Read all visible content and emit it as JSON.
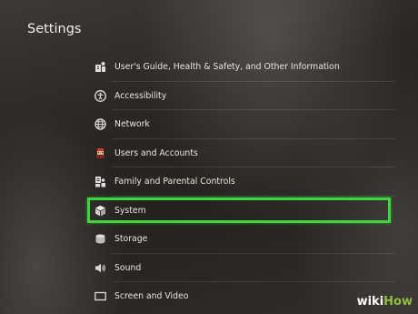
{
  "page_title": "Settings",
  "menu": [
    {
      "label": "User's Guide, Health & Safety, and Other Information",
      "icon": "guide-icon"
    },
    {
      "label": "Accessibility",
      "icon": "accessibility-icon"
    },
    {
      "label": "Network",
      "icon": "network-globe-icon"
    },
    {
      "label": "Users and Accounts",
      "icon": "user-avatar-icon"
    },
    {
      "label": "Family and Parental Controls",
      "icon": "family-icon"
    },
    {
      "label": "System",
      "icon": "system-cube-icon",
      "selected": true
    },
    {
      "label": "Storage",
      "icon": "storage-icon"
    },
    {
      "label": "Sound",
      "icon": "speaker-icon"
    },
    {
      "label": "Screen and Video",
      "icon": "screen-icon"
    }
  ],
  "highlight_color": "#3bd83b",
  "watermark": {
    "wiki": "wiki",
    "how": "How"
  }
}
